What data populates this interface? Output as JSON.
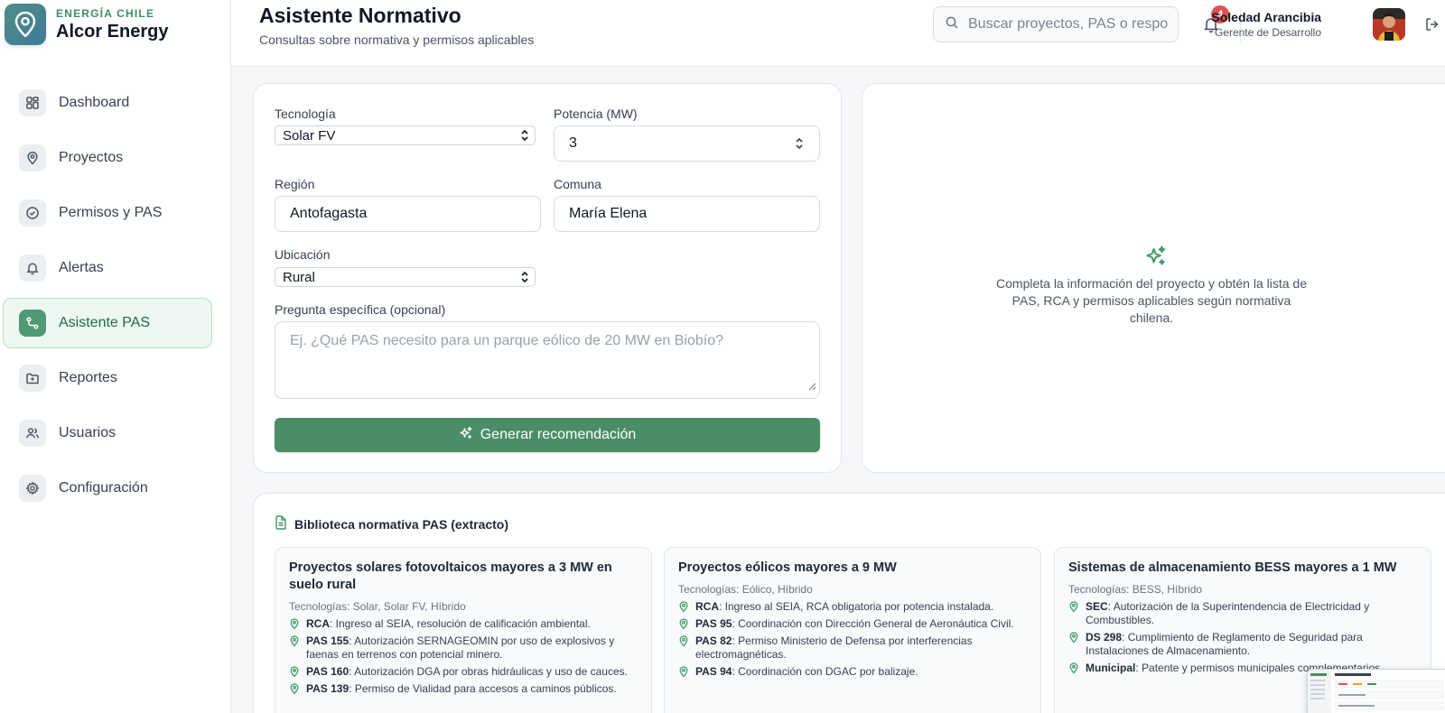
{
  "brand": {
    "kicker": "ENERGÍA CHILE",
    "name": "Alcor Energy"
  },
  "sidebar": {
    "items": [
      {
        "label": "Dashboard",
        "icon": "grid-icon"
      },
      {
        "label": "Proyectos",
        "icon": "map-pin-icon"
      },
      {
        "label": "Permisos y PAS",
        "icon": "check-circle-icon"
      },
      {
        "label": "Alertas",
        "icon": "bell-icon"
      },
      {
        "label": "Asistente PAS",
        "icon": "route-icon",
        "active": true
      },
      {
        "label": "Reportes",
        "icon": "folder-plus-icon"
      },
      {
        "label": "Usuarios",
        "icon": "users-icon"
      },
      {
        "label": "Configuración",
        "icon": "gear-icon"
      }
    ]
  },
  "header": {
    "title": "Asistente Normativo",
    "subtitle": "Consultas sobre normativa y permisos aplicables",
    "search_placeholder": "Buscar proyectos, PAS o responsables",
    "notifications": "4",
    "user_name": "Soledad Arancibia",
    "user_role": "Gerente de Desarrollo"
  },
  "form": {
    "tecnologia_label": "Tecnología",
    "tecnologia_value": "Solar FV",
    "potencia_label": "Potencia (MW)",
    "potencia_value": "3",
    "region_label": "Región",
    "region_value": "Antofagasta",
    "comuna_label": "Comuna",
    "comuna_value": "María Elena",
    "ubicacion_label": "Ubicación",
    "ubicacion_value": "Rural",
    "pregunta_label": "Pregunta específica (opcional)",
    "pregunta_placeholder": "Ej. ¿Qué PAS necesito para un parque eólico de 20 MW en Biobío?",
    "submit_label": "Generar recomendación"
  },
  "result": {
    "empty_text": "Completa la información del proyecto y obtén la lista de PAS, RCA y permisos aplicables según normativa chilena."
  },
  "library": {
    "title": "Biblioteca normativa PAS (extracto)",
    "items": [
      {
        "title": "Proyectos solares fotovoltaicos mayores a 3 MW en suelo rural",
        "tech": "Tecnologías: Solar, Solar FV, Híbrido",
        "rules": [
          {
            "code": "RCA",
            "text": ": Ingreso al SEIA, resolución de calificación ambiental."
          },
          {
            "code": "PAS 155",
            "text": ": Autorización SERNAGEOMIN por uso de explosivos y faenas en terrenos con potencial minero."
          },
          {
            "code": "PAS 160",
            "text": ": Autorización DGA por obras hidráulicas y uso de cauces."
          },
          {
            "code": "PAS 139",
            "text": ": Permiso de Vialidad para accesos a caminos públicos."
          }
        ]
      },
      {
        "title": "Proyectos eólicos mayores a 9 MW",
        "tech": "Tecnologías: Eólico, Híbrido",
        "rules": [
          {
            "code": "RCA",
            "text": ": Ingreso al SEIA, RCA obligatoria por potencia instalada."
          },
          {
            "code": "PAS 95",
            "text": ": Coordinación con Dirección General de Aeronáutica Civil."
          },
          {
            "code": "PAS 82",
            "text": ": Permiso Ministerio de Defensa por interferencias electromagnéticas."
          },
          {
            "code": "PAS 94",
            "text": ": Coordinación con DGAC por balizaje."
          }
        ]
      },
      {
        "title": "Sistemas de almacenamiento BESS mayores a 1 MW",
        "tech": "Tecnologías: BESS, Híbrido",
        "rules": [
          {
            "code": "SEC",
            "text": ": Autorización de la Superintendencia de Electricidad y Combustibles."
          },
          {
            "code": "DS 298",
            "text": ": Cumplimiento de Reglamento de Seguridad para Instalaciones de Almacenamiento."
          },
          {
            "code": "Municipal",
            "text": ": Patente y permisos municipales complementarios."
          }
        ]
      }
    ]
  },
  "colors": {
    "accent": "#4a8d67",
    "brand_kicker": "#3f8f63",
    "badge": "#e05252"
  }
}
